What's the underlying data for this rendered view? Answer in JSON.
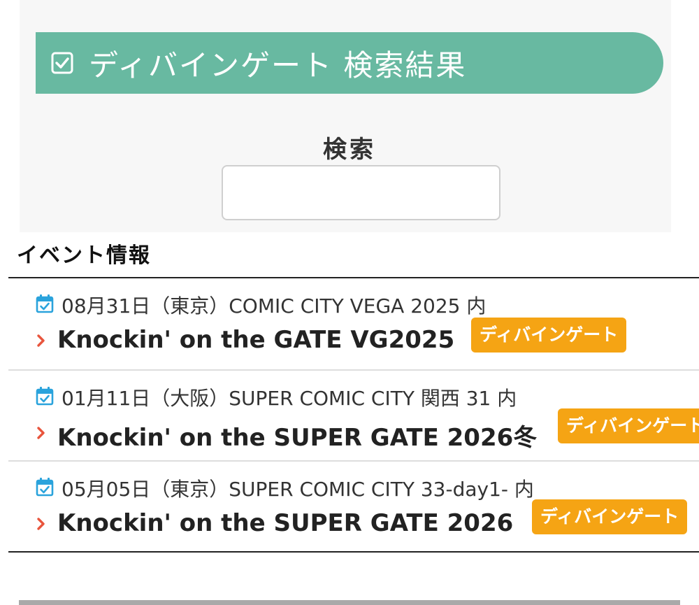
{
  "header": {
    "title": "ディバインゲート 検索結果",
    "accent_color": "#68b9a1",
    "icon": "checkbox-icon"
  },
  "search": {
    "label": "検索",
    "value": "",
    "placeholder": ""
  },
  "events_section": {
    "title": "イベント情報",
    "items": [
      {
        "date": "08月31日（東京）COMIC CITY VEGA 2025 内",
        "name": "Knockin' on the GATE VG2025",
        "badge": "ディバインゲート"
      },
      {
        "date": "01月11日（大阪）SUPER COMIC CITY 関西 31 内",
        "name": "Knockin' on the SUPER GATE 2026冬",
        "badge": "ディバインゲート"
      },
      {
        "date": "05月05日（東京）SUPER COMIC CITY 33-day1- 内",
        "name": "Knockin' on the SUPER GATE 2026",
        "badge": "ディバインゲート"
      }
    ],
    "icon_color": "#2aa3dc",
    "chevron_color": "#e8553d",
    "badge_color": "#f5a414"
  }
}
